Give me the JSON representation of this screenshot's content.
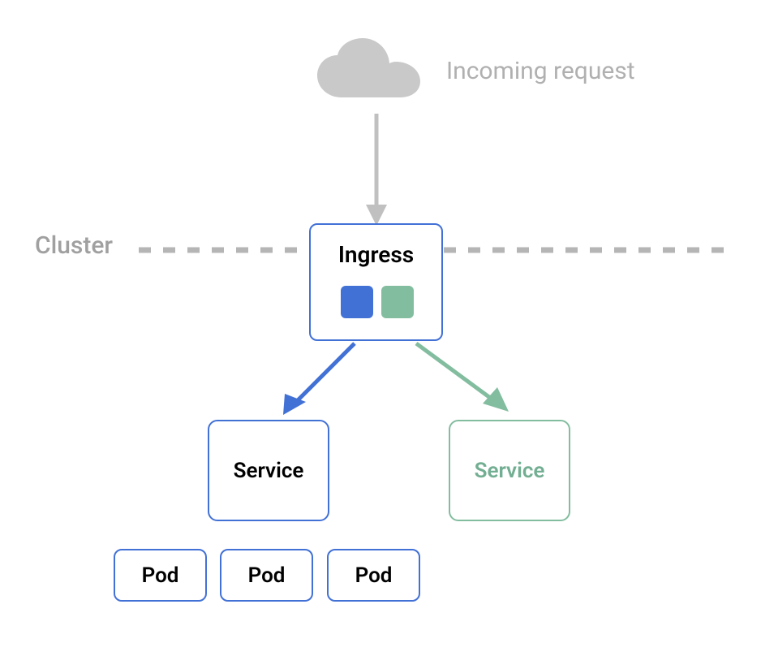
{
  "incoming_request_label": "Incoming request",
  "cluster_label": "Cluster",
  "ingress": {
    "label": "Ingress"
  },
  "services": {
    "blue": {
      "label": "Service"
    },
    "green": {
      "label": "Service"
    }
  },
  "pods": [
    {
      "label": "Pod"
    },
    {
      "label": "Pod"
    },
    {
      "label": "Pod"
    }
  ],
  "colors": {
    "blue": "#4271d6",
    "green": "#83bd9f",
    "gray": "#b0b0b0",
    "cluster_gray": "#a0a0a0"
  }
}
